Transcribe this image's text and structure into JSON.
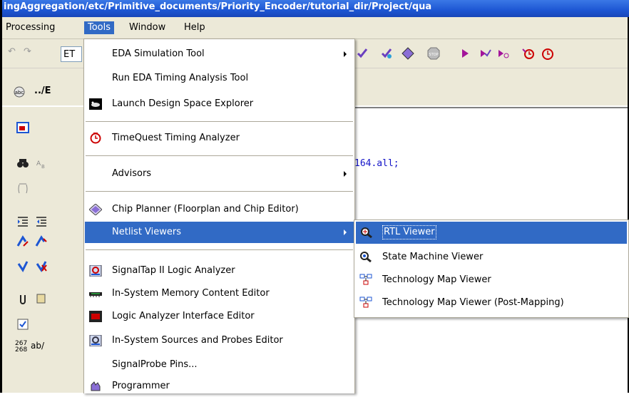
{
  "titlebar": {
    "text": "ingAggregation/etc/Primitive_documents/Priority_Encoder/tutorial_dir/Project/qua"
  },
  "menubar": {
    "items": [
      {
        "label": "Processing"
      },
      {
        "label": "Tools",
        "active": true
      },
      {
        "label": "Window"
      },
      {
        "label": "Help"
      }
    ]
  },
  "toolbar": {
    "combo_value": "ET",
    "path_label": "../E"
  },
  "editor": {
    "code_line": "164.all;"
  },
  "leftbar": {
    "counter_top": "267",
    "counter_bottom": "268",
    "ab_label": "ab/"
  },
  "tools_menu": {
    "items": [
      {
        "label": "EDA Simulation Tool",
        "submenu": true
      },
      {
        "label": "Run EDA Timing Analysis Tool"
      },
      {
        "label": "Launch Design Space Explorer"
      },
      {
        "label": "TimeQuest Timing Analyzer"
      },
      {
        "label": "Advisors",
        "submenu": true
      },
      {
        "label": "Chip Planner (Floorplan and Chip Editor)"
      },
      {
        "label": "Netlist Viewers",
        "submenu": true,
        "highlighted": true
      },
      {
        "label": "SignalTap II Logic Analyzer"
      },
      {
        "label": "In-System Memory Content Editor"
      },
      {
        "label": "Logic Analyzer Interface Editor"
      },
      {
        "label": "In-System Sources and Probes Editor"
      },
      {
        "label": "SignalProbe Pins..."
      },
      {
        "label": "Programmer"
      }
    ]
  },
  "netlist_submenu": {
    "items": [
      {
        "label": "RTL Viewer",
        "highlighted": true
      },
      {
        "label": "State Machine Viewer"
      },
      {
        "label": "Technology Map Viewer"
      },
      {
        "label": "Technology Map Viewer (Post-Mapping)"
      }
    ]
  },
  "colors": {
    "menu_highlight": "#316ac5",
    "chrome": "#ece9d8",
    "titlebar": "#1d56d3"
  }
}
